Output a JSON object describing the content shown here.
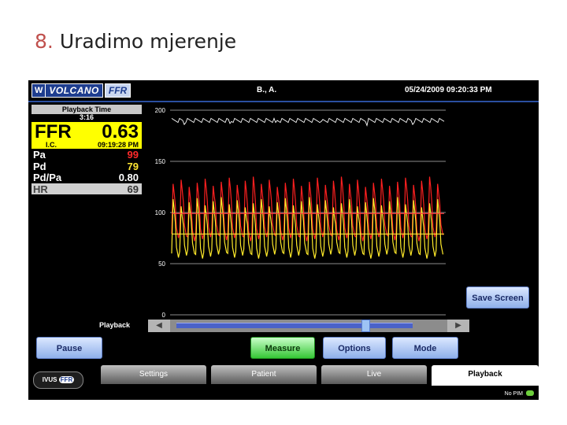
{
  "slide": {
    "number": "8.",
    "title": "Uradimo mjerenje"
  },
  "header": {
    "brand_w": "W",
    "brand": "VOLCANO",
    "brand_ffr": "FFR",
    "patient": "B., A.",
    "datetime": "05/24/2009 09:20:33 PM"
  },
  "panel": {
    "playback_time_label": "Playback Time",
    "playback_time": "3:16",
    "ffr_label": "FFR",
    "ffr_value": "0.63",
    "ffr_sub": "I.C.",
    "ffr_time": "09:19:28 PM",
    "rows": [
      {
        "label": "Pa",
        "value": "99",
        "color": "#ff2a2a"
      },
      {
        "label": "Pd",
        "value": "79",
        "color": "#ffe633"
      },
      {
        "label": "Pd/Pa",
        "value": "0.80",
        "color": "#ffffff"
      },
      {
        "label": "HR",
        "value": "69",
        "color": "#333333"
      }
    ]
  },
  "chart_data": {
    "type": "line",
    "y_ticks": [
      "200",
      "150",
      "100",
      "50",
      "0"
    ],
    "ylim": [
      0,
      200
    ],
    "grid": true,
    "series": [
      {
        "color": "#ff2020",
        "systolic": 130,
        "diastolic": 75
      },
      {
        "color": "#ffea2a",
        "systolic": 110,
        "diastolic": 58
      },
      {
        "color": "#ffffff",
        "level": 190
      }
    ],
    "mean_lines": [
      {
        "color": "#ff3b3b",
        "value": 99
      },
      {
        "color": "#ffe633",
        "value": 79
      }
    ],
    "beats": 34
  },
  "playback": {
    "label": "Playback",
    "position": 0.8
  },
  "buttons": {
    "save_screen": "Save Screen",
    "pause": "Pause",
    "measure": "Measure",
    "options": "Options",
    "mode": "Mode"
  },
  "tabs": {
    "settings": "Settings",
    "patient": "Patient",
    "live": "Live",
    "playback": "Playback"
  },
  "footer": {
    "ivus": "IVUS",
    "ffr": "FFR",
    "status": "No PIM"
  }
}
